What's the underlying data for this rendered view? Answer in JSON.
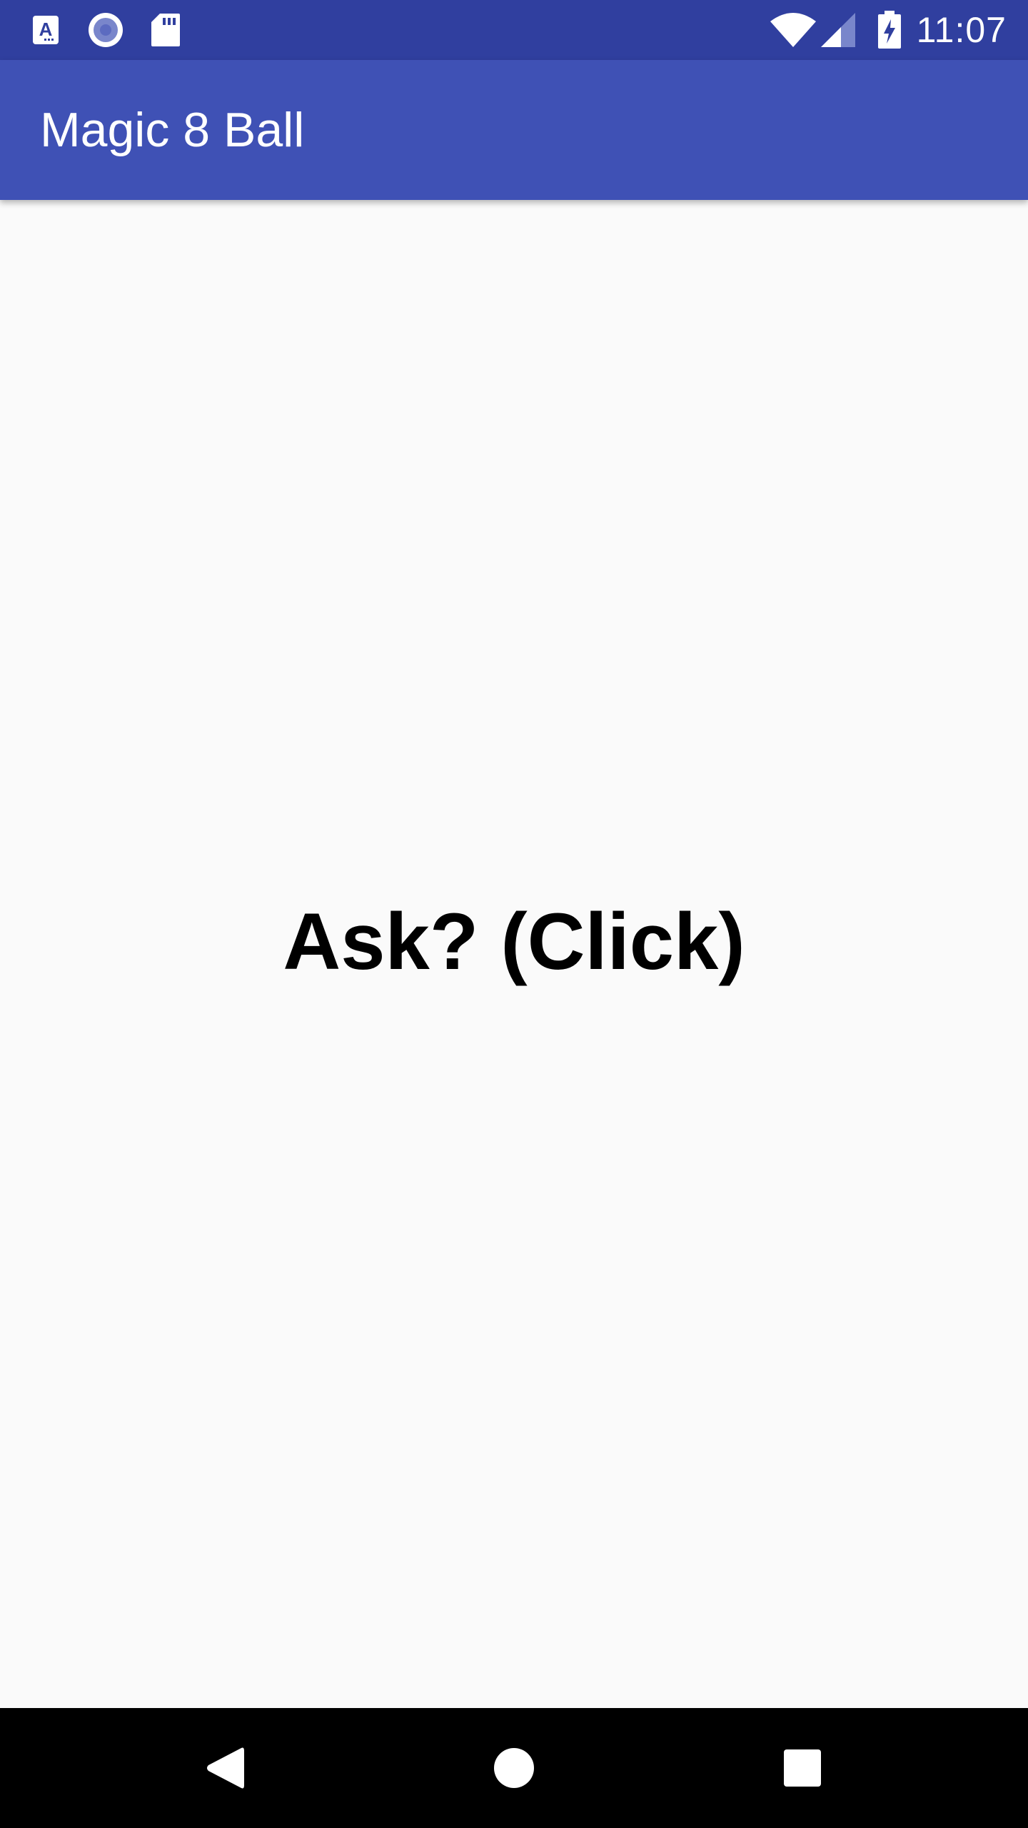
{
  "status_bar": {
    "time": "11:07",
    "notification_icons": [
      "font-a-icon",
      "record-circle-icon",
      "sd-card-icon"
    ],
    "system_icons": [
      "wifi-icon",
      "cell-signal-icon",
      "battery-charging-icon"
    ],
    "background": "#303f9f"
  },
  "app_bar": {
    "title": "Magic 8 Ball",
    "background": "#3f51b5"
  },
  "main": {
    "ask_label": "Ask? (Click)",
    "background": "#fafafa"
  },
  "nav_bar": {
    "buttons": [
      "back-icon",
      "home-icon",
      "recents-icon"
    ],
    "background": "#000000"
  }
}
